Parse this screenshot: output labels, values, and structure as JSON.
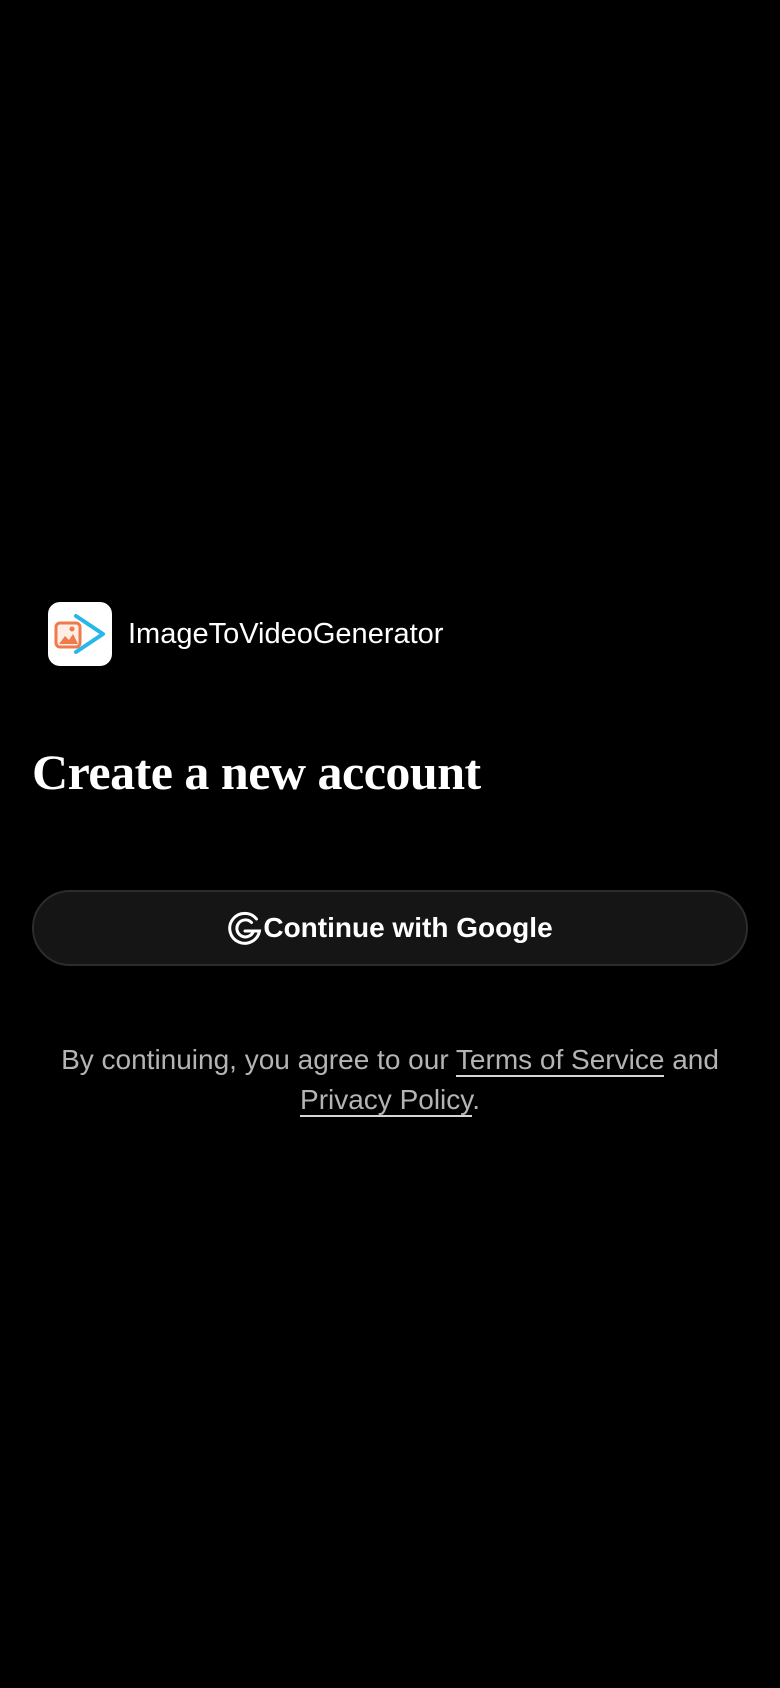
{
  "app": {
    "name": "ImageToVideoGenerator",
    "logo_icon": "image-to-video-logo-icon"
  },
  "auth": {
    "heading": "Create a new account",
    "google_button_label": "Continue with Google",
    "google_icon": "google-g-icon"
  },
  "legal": {
    "prefix": "By continuing, you agree to our ",
    "terms_link": "Terms of Service",
    "middle": " and ",
    "privacy_link": "Privacy Policy",
    "suffix": "."
  },
  "colors": {
    "background": "#000000",
    "button_background": "#151515",
    "logo_orange": "#f07a4a",
    "logo_blue": "#29b6e8",
    "muted_text": "#b4b4b4"
  }
}
